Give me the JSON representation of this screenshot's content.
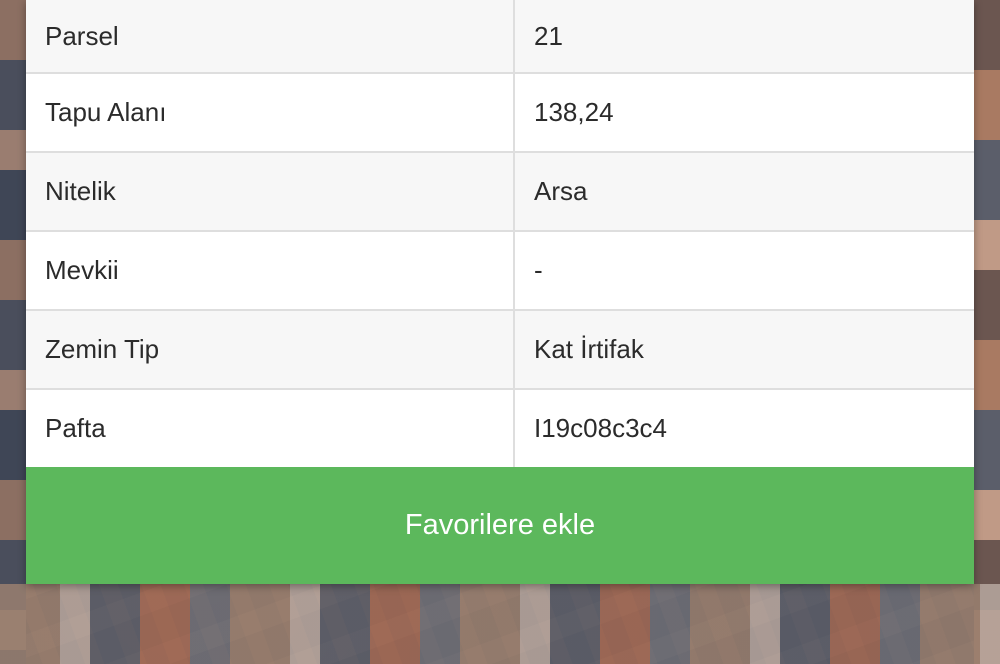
{
  "parcel_info": {
    "rows": [
      {
        "label": "Parsel",
        "value": "21"
      },
      {
        "label": "Tapu Alanı",
        "value": "138,24"
      },
      {
        "label": "Nitelik",
        "value": "Arsa"
      },
      {
        "label": "Mevkii",
        "value": "-"
      },
      {
        "label": "Zemin Tip",
        "value": "Kat İrtifak"
      },
      {
        "label": "Pafta",
        "value": "I19c08c3c4"
      }
    ]
  },
  "actions": {
    "favorite_label": "Favorilere ekle"
  },
  "colors": {
    "button_bg": "#5cb85c",
    "button_text": "#ffffff"
  }
}
